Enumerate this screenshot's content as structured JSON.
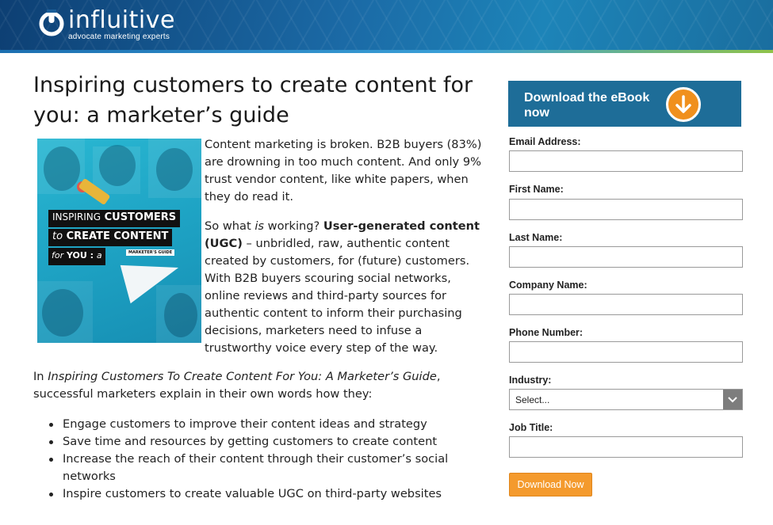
{
  "header": {
    "logo_name": "influitive",
    "logo_tagline": "advocate marketing experts",
    "logo_icon": "power-icon"
  },
  "main": {
    "title": "Inspiring customers to create content for you: a marketer’s guide",
    "cover": {
      "line1a": "INSPIRING",
      "line1b": "CUSTOMERS",
      "line2a": "to",
      "line2b": "CREATE CONTENT",
      "line3a": "for",
      "line3b": "YOU",
      "line3c": "a",
      "line3d": "MARKETER'S GUIDE"
    },
    "intro": "Content marketing is broken. B2B buyers (83%) are drowning in too much content. And only 9% trust vendor content, like white papers, when they do read it.",
    "p2_a": "So what ",
    "p2_b": "is",
    "p2_c": " working? ",
    "p2_d": "User-generated content (UGC)",
    "p2_e": " – unbridled, raw, authentic content created by customers, for (future) customers. With B2B buyers scouring social networks, online reviews and third-party sources for authentic content to inform their purchasing decisions, marketers need to infuse a trustworthy voice every step of the way.",
    "p3_a": "In ",
    "p3_b": "Inspiring Customers To Create Content For You: A Marketer’s Guide",
    "p3_c": ", successful marketers explain in their own words how they:",
    "bullets": [
      "Engage customers to improve their content ideas and strategy",
      "Save time and resources by getting customers to create content",
      "Increase the reach of their content through their customer’s social networks",
      "Inspire customers to create valuable UGC on third-party websites"
    ]
  },
  "form": {
    "banner_text": "Download the eBook now",
    "banner_icon": "arrow-down-circle-icon",
    "fields": {
      "email_label": "Email Address:",
      "first_label": "First Name:",
      "last_label": "Last Name:",
      "company_label": "Company Name:",
      "phone_label": "Phone Number:",
      "industry_label": "Industry:",
      "industry_value": "Select...",
      "job_label": "Job Title:"
    },
    "submit_label": "Download Now"
  }
}
